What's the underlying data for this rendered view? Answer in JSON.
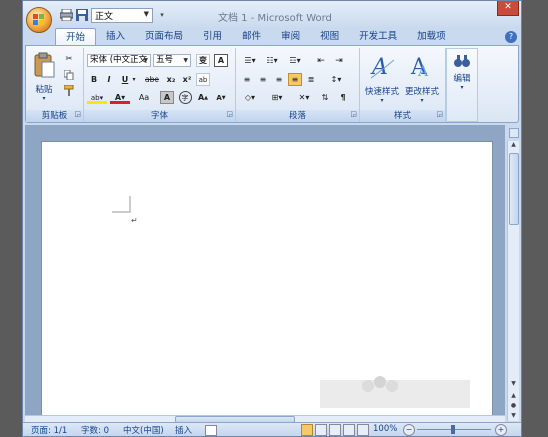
{
  "window": {
    "title": "文档 1 - Microsoft Word"
  },
  "qat": {
    "style_value": "正文"
  },
  "tabs": [
    "开始",
    "插入",
    "页面布局",
    "引用",
    "邮件",
    "审阅",
    "视图",
    "开发工具",
    "加载项"
  ],
  "clipboard": {
    "paste_label": "粘贴",
    "group_label": "剪贴板"
  },
  "font": {
    "name": "宋体 (中文正文",
    "size": "五号",
    "group_label": "字体",
    "grow": "A",
    "shrink": "A",
    "phonetic": "变",
    "border_char": "A",
    "bold": "B",
    "italic": "I",
    "underline": "U",
    "strike": "abe",
    "sub": "x₂",
    "sup": "x²",
    "clear": "ab",
    "change_case": "Aa",
    "shade_char": "A",
    "enclose": "字"
  },
  "paragraph": {
    "group_label": "段落"
  },
  "styles": {
    "quick_label": "快速样式",
    "change_label": "更改样式",
    "group_label": "样式"
  },
  "editing": {
    "label": "编辑"
  },
  "statusbar": {
    "page": "页面: 1/1",
    "words": "字数: 0",
    "lang": "中文(中国)",
    "mode": "插入",
    "zoom": "100%"
  },
  "colors": {
    "accent": "#15428b",
    "frame": "#c9d9ee",
    "ribbon": "#dbe6f4",
    "office_button": "#f2a43a"
  }
}
